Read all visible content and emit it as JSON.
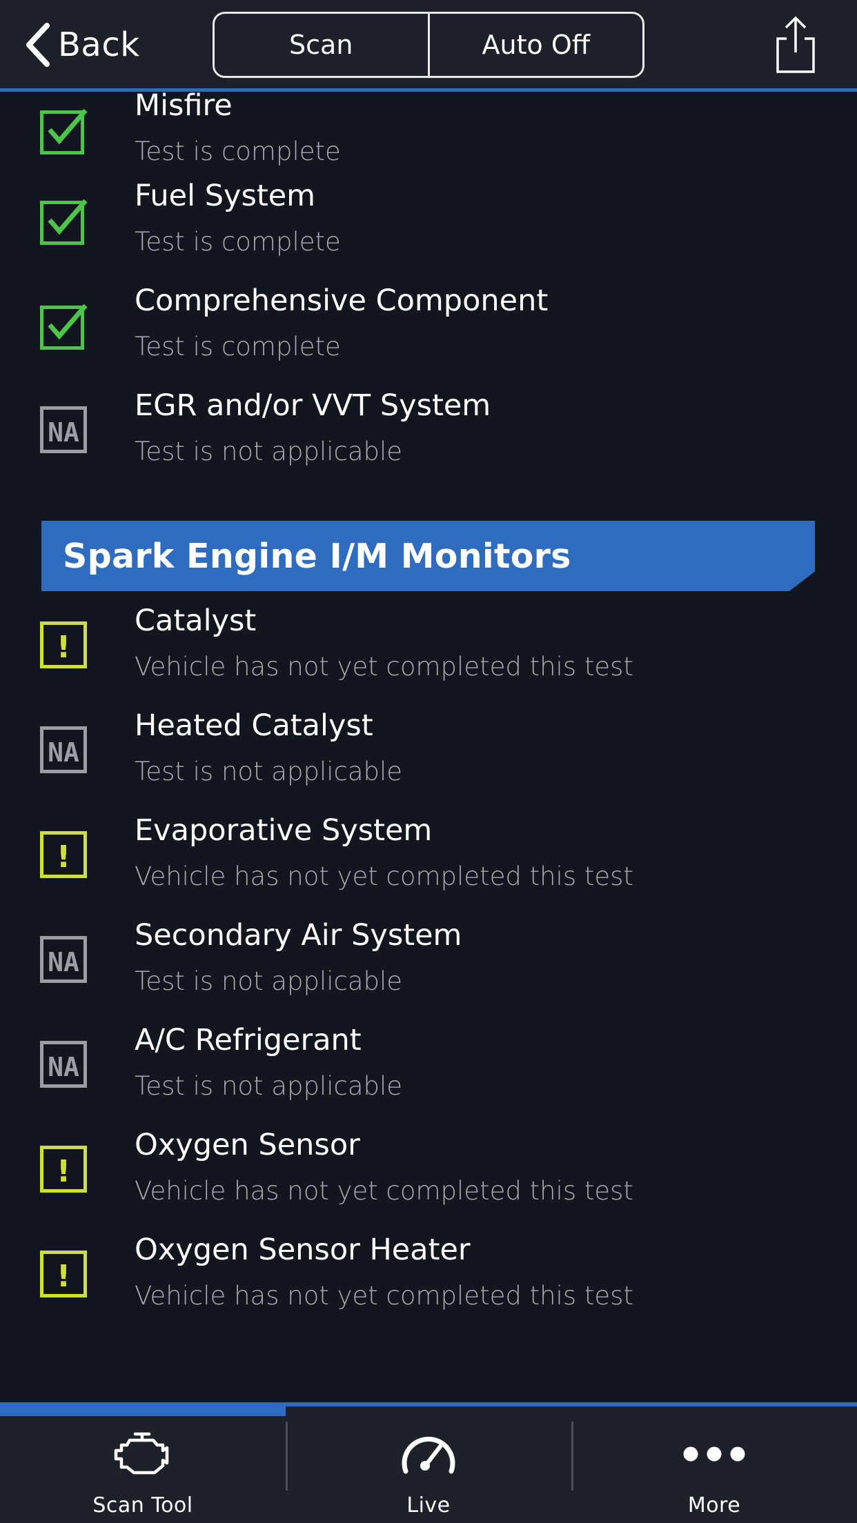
{
  "header": {
    "back_label": "Back",
    "segments": [
      "Scan",
      "Auto Off"
    ],
    "share_icon": "share-icon"
  },
  "monitors_top": [
    {
      "title": "Misfire",
      "subtitle": "Test is complete",
      "status": "complete"
    },
    {
      "title": "Fuel System",
      "subtitle": "Test is complete",
      "status": "complete"
    },
    {
      "title": "Comprehensive Component",
      "subtitle": "Test is complete",
      "status": "complete"
    },
    {
      "title": "EGR and/or VVT System",
      "subtitle": "Test is not applicable",
      "status": "na"
    }
  ],
  "section": {
    "title": "Spark Engine I/M Monitors"
  },
  "monitors_spark": [
    {
      "title": "Catalyst",
      "subtitle": "Vehicle has not yet completed this test",
      "status": "incomplete"
    },
    {
      "title": "Heated Catalyst",
      "subtitle": "Test is not applicable",
      "status": "na"
    },
    {
      "title": "Evaporative System",
      "subtitle": "Vehicle has not yet completed this test",
      "status": "incomplete"
    },
    {
      "title": "Secondary Air System",
      "subtitle": "Test is not applicable",
      "status": "na"
    },
    {
      "title": "A/C Refrigerant",
      "subtitle": "Test is not applicable",
      "status": "na"
    },
    {
      "title": "Oxygen Sensor",
      "subtitle": "Vehicle has not yet completed this test",
      "status": "incomplete"
    },
    {
      "title": "Oxygen Sensor Heater",
      "subtitle": "Vehicle has not yet completed this test",
      "status": "incomplete"
    }
  ],
  "status_icons": {
    "na_text": "NA",
    "warning_text": "!"
  },
  "tabs": [
    {
      "label": "Scan Tool",
      "icon": "engine-icon"
    },
    {
      "label": "Live",
      "icon": "speedometer-icon"
    },
    {
      "label": "More",
      "icon": "more-icon"
    }
  ],
  "colors": {
    "background": "#13161e",
    "bar": "#1e2129",
    "accent": "#2f6cc0",
    "complete": "#4cc54a",
    "warning": "#cfe03a",
    "na": "#9b9ea4",
    "subtitle": "#a9adb5"
  }
}
